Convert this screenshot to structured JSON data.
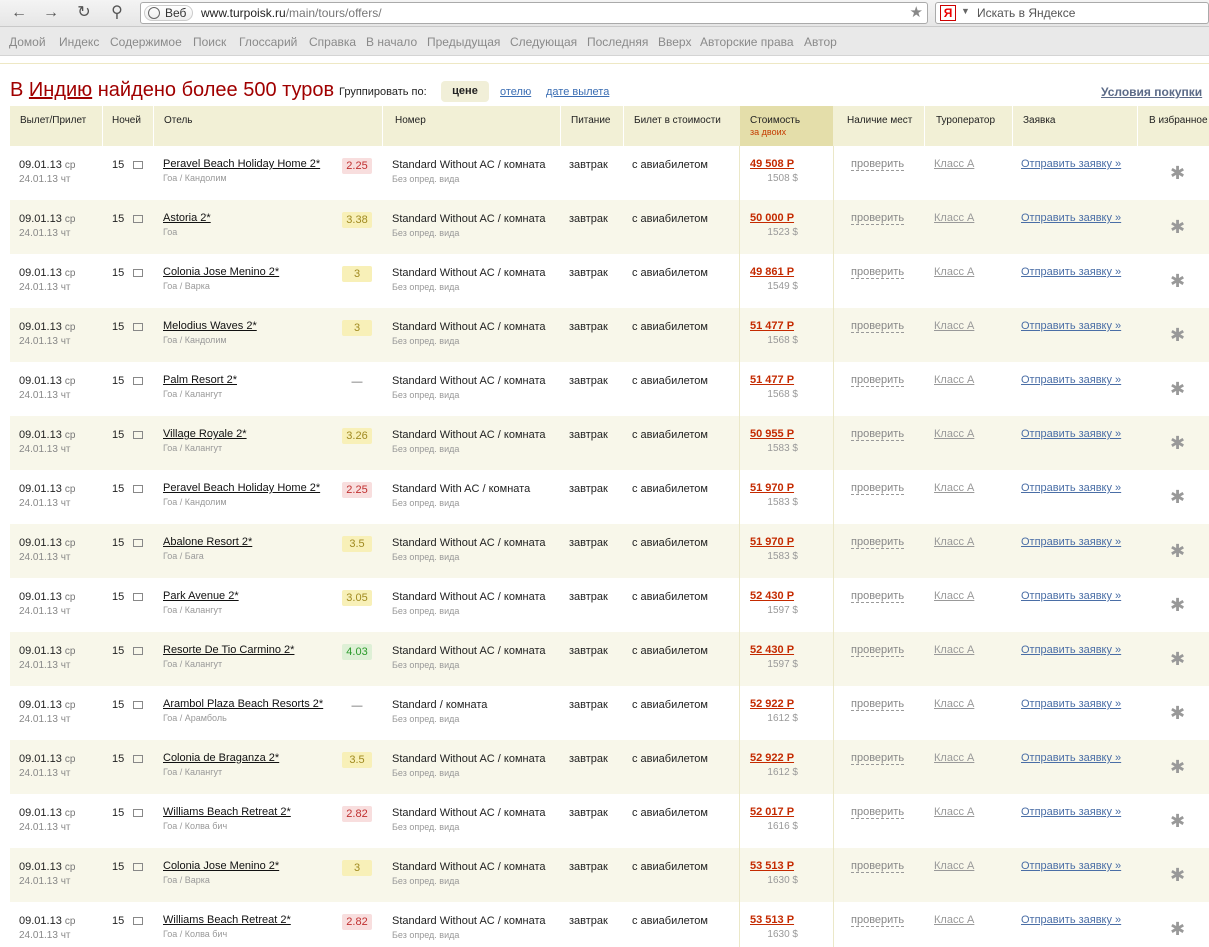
{
  "browser": {
    "url_host": "www.turpoisk.ru",
    "url_path": "/main/tours/offers/",
    "web_label": "Веб",
    "search_placeholder": "Искать в Яндексе",
    "search_logo": "Я"
  },
  "bookmarks": [
    "Домой",
    "Индекс",
    "Содержимое",
    "Поиск",
    "Глоссарий",
    "Справка",
    "В начало",
    "Предыдущая",
    "Следующая",
    "Последняя",
    "Вверх",
    "Авторские права",
    "Автор"
  ],
  "headline": {
    "prefix": "В ",
    "country": "Индию",
    "suffix": " найдено более 500 туров"
  },
  "grouping": {
    "label": "Группировать по:",
    "active": "цене",
    "options": [
      "отелю",
      "дате вылета"
    ]
  },
  "conditions_link": "Условия покупки",
  "columns": {
    "dates": "Вылет/Прилет",
    "nights": "Ночей",
    "hotel": "Отель",
    "room": "Номер",
    "meal": "Питание",
    "ticket": "Билет в стоимости",
    "price": "Стоимость",
    "price_sub": "за двоих",
    "availability": "Наличие мест",
    "operator": "Туроператор",
    "request": "Заявка",
    "favorites": "В избранное"
  },
  "colors": {
    "rating_red_bg": "#f8dede",
    "rating_yellow_bg": "#f8f0b8",
    "rating_green_bg": "#def0d6",
    "accent": "#a00000"
  },
  "rows": [
    {
      "dep": "09.01.13",
      "dep_day": "ср",
      "ret": "24.01.13 чт",
      "nights": "15",
      "hotel": "Peravel Beach Holiday Home 2*",
      "loc": "Гоа / Кандолим",
      "rating": "2.25",
      "rating_color": "red",
      "room": "Standard Without AC / комната",
      "view": "Без опред. вида",
      "meal": "завтрак",
      "ticket": "с авиабилетом",
      "price": "49 508 Р",
      "usd": "1508 $",
      "check": "проверить",
      "operator": "Класс А",
      "send": "Отправить заявку »",
      "fav": "✱"
    },
    {
      "dep": "09.01.13",
      "dep_day": "ср",
      "ret": "24.01.13 чт",
      "nights": "15",
      "hotel": "Astoria 2*",
      "loc": "Гоа",
      "rating": "3.38",
      "rating_color": "yellow",
      "room": "Standard Without AC / комната",
      "view": "Без опред. вида",
      "meal": "завтрак",
      "ticket": "с авиабилетом",
      "price": "50 000 Р",
      "usd": "1523 $",
      "check": "проверить",
      "operator": "Класс А",
      "send": "Отправить заявку »",
      "fav": "✱"
    },
    {
      "dep": "09.01.13",
      "dep_day": "ср",
      "ret": "24.01.13 чт",
      "nights": "15",
      "hotel": "Colonia Jose Menino 2*",
      "loc": "Гоа / Варка",
      "rating": "3",
      "rating_color": "yellow",
      "room": "Standard Without AC / комната",
      "view": "Без опред. вида",
      "meal": "завтрак",
      "ticket": "с авиабилетом",
      "price": "49 861 Р",
      "usd": "1549 $",
      "check": "проверить",
      "operator": "Класс А",
      "send": "Отправить заявку »",
      "fav": "✱"
    },
    {
      "dep": "09.01.13",
      "dep_day": "ср",
      "ret": "24.01.13 чт",
      "nights": "15",
      "hotel": "Melodius Waves 2*",
      "loc": "Гоа / Кандолим",
      "rating": "3",
      "rating_color": "yellow",
      "room": "Standard Without AC / комната",
      "view": "Без опред. вида",
      "meal": "завтрак",
      "ticket": "с авиабилетом",
      "price": "51 477 Р",
      "usd": "1568 $",
      "check": "проверить",
      "operator": "Класс А",
      "send": "Отправить заявку »",
      "fav": "✱"
    },
    {
      "dep": "09.01.13",
      "dep_day": "ср",
      "ret": "24.01.13 чт",
      "nights": "15",
      "hotel": "Palm Resort 2*",
      "loc": "Гоа / Калангут",
      "rating": "—",
      "rating_color": "none",
      "room": "Standard Without AC / комната",
      "view": "Без опред. вида",
      "meal": "завтрак",
      "ticket": "с авиабилетом",
      "price": "51 477 Р",
      "usd": "1568 $",
      "check": "проверить",
      "operator": "Класс А",
      "send": "Отправить заявку »",
      "fav": "✱"
    },
    {
      "dep": "09.01.13",
      "dep_day": "ср",
      "ret": "24.01.13 чт",
      "nights": "15",
      "hotel": "Village Royale 2*",
      "loc": "Гоа / Калангут",
      "rating": "3.26",
      "rating_color": "yellow",
      "room": "Standard Without AC / комната",
      "view": "Без опред. вида",
      "meal": "завтрак",
      "ticket": "с авиабилетом",
      "price": "50 955 Р",
      "usd": "1583 $",
      "check": "проверить",
      "operator": "Класс А",
      "send": "Отправить заявку »",
      "fav": "✱"
    },
    {
      "dep": "09.01.13",
      "dep_day": "ср",
      "ret": "24.01.13 чт",
      "nights": "15",
      "hotel": "Peravel Beach Holiday Home 2*",
      "loc": "Гоа / Кандолим",
      "rating": "2.25",
      "rating_color": "red",
      "room": "Standard With AC / комната",
      "view": "Без опред. вида",
      "meal": "завтрак",
      "ticket": "с авиабилетом",
      "price": "51 970 Р",
      "usd": "1583 $",
      "check": "проверить",
      "operator": "Класс А",
      "send": "Отправить заявку »",
      "fav": "✱"
    },
    {
      "dep": "09.01.13",
      "dep_day": "ср",
      "ret": "24.01.13 чт",
      "nights": "15",
      "hotel": "Abalone Resort 2*",
      "loc": "Гоа / Бага",
      "rating": "3.5",
      "rating_color": "yellow",
      "room": "Standard Without AC / комната",
      "view": "Без опред. вида",
      "meal": "завтрак",
      "ticket": "с авиабилетом",
      "price": "51 970 Р",
      "usd": "1583 $",
      "check": "проверить",
      "operator": "Класс А",
      "send": "Отправить заявку »",
      "fav": "✱"
    },
    {
      "dep": "09.01.13",
      "dep_day": "ср",
      "ret": "24.01.13 чт",
      "nights": "15",
      "hotel": "Park Avenue 2*",
      "loc": "Гоа / Калангут",
      "rating": "3.05",
      "rating_color": "yellow",
      "room": "Standard Without AC / комната",
      "view": "Без опред. вида",
      "meal": "завтрак",
      "ticket": "с авиабилетом",
      "price": "52 430 Р",
      "usd": "1597 $",
      "check": "проверить",
      "operator": "Класс А",
      "send": "Отправить заявку »",
      "fav": "✱"
    },
    {
      "dep": "09.01.13",
      "dep_day": "ср",
      "ret": "24.01.13 чт",
      "nights": "15",
      "hotel": "Resorte De Tio Carmino 2*",
      "loc": "Гоа / Калангут",
      "rating": "4.03",
      "rating_color": "green",
      "room": "Standard Without AC / комната",
      "view": "Без опред. вида",
      "meal": "завтрак",
      "ticket": "с авиабилетом",
      "price": "52 430 Р",
      "usd": "1597 $",
      "check": "проверить",
      "operator": "Класс А",
      "send": "Отправить заявку »",
      "fav": "✱"
    },
    {
      "dep": "09.01.13",
      "dep_day": "ср",
      "ret": "24.01.13 чт",
      "nights": "15",
      "hotel": "Arambol Plaza Beach Resorts 2*",
      "loc": "Гоа / Арамболь",
      "rating": "—",
      "rating_color": "none",
      "room": "Standard / комната",
      "view": "Без опред. вида",
      "meal": "завтрак",
      "ticket": "с авиабилетом",
      "price": "52 922 Р",
      "usd": "1612 $",
      "check": "проверить",
      "operator": "Класс А",
      "send": "Отправить заявку »",
      "fav": "✱"
    },
    {
      "dep": "09.01.13",
      "dep_day": "ср",
      "ret": "24.01.13 чт",
      "nights": "15",
      "hotel": "Colonia de Braganza 2*",
      "loc": "Гоа / Калангут",
      "rating": "3.5",
      "rating_color": "yellow",
      "room": "Standard Without AC / комната",
      "view": "Без опред. вида",
      "meal": "завтрак",
      "ticket": "с авиабилетом",
      "price": "52 922 Р",
      "usd": "1612 $",
      "check": "проверить",
      "operator": "Класс А",
      "send": "Отправить заявку »",
      "fav": "✱"
    },
    {
      "dep": "09.01.13",
      "dep_day": "ср",
      "ret": "24.01.13 чт",
      "nights": "15",
      "hotel": "Williams Beach Retreat 2*",
      "loc": "Гоа / Колва бич",
      "rating": "2.82",
      "rating_color": "red",
      "room": "Standard Without AC / комната",
      "view": "Без опред. вида",
      "meal": "завтрак",
      "ticket": "с авиабилетом",
      "price": "52 017 Р",
      "usd": "1616 $",
      "check": "проверить",
      "operator": "Класс А",
      "send": "Отправить заявку »",
      "fav": "✱"
    },
    {
      "dep": "09.01.13",
      "dep_day": "ср",
      "ret": "24.01.13 чт",
      "nights": "15",
      "hotel": "Colonia Jose Menino 2*",
      "loc": "Гоа / Варка",
      "rating": "3",
      "rating_color": "yellow",
      "room": "Standard Without AC / комната",
      "view": "Без опред. вида",
      "meal": "завтрак",
      "ticket": "с авиабилетом",
      "price": "53 513 Р",
      "usd": "1630 $",
      "check": "проверить",
      "operator": "Класс А",
      "send": "Отправить заявку »",
      "fav": "✱"
    },
    {
      "dep": "09.01.13",
      "dep_day": "ср",
      "ret": "24.01.13 чт",
      "nights": "15",
      "hotel": "Williams Beach Retreat 2*",
      "loc": "Гоа / Колва бич",
      "rating": "2.82",
      "rating_color": "red",
      "room": "Standard Without AC / комната",
      "view": "Без опред. вида",
      "meal": "завтрак",
      "ticket": "с авиабилетом",
      "price": "53 513 Р",
      "usd": "1630 $",
      "check": "проверить",
      "operator": "Класс А",
      "send": "Отправить заявку »",
      "fav": "✱"
    }
  ]
}
